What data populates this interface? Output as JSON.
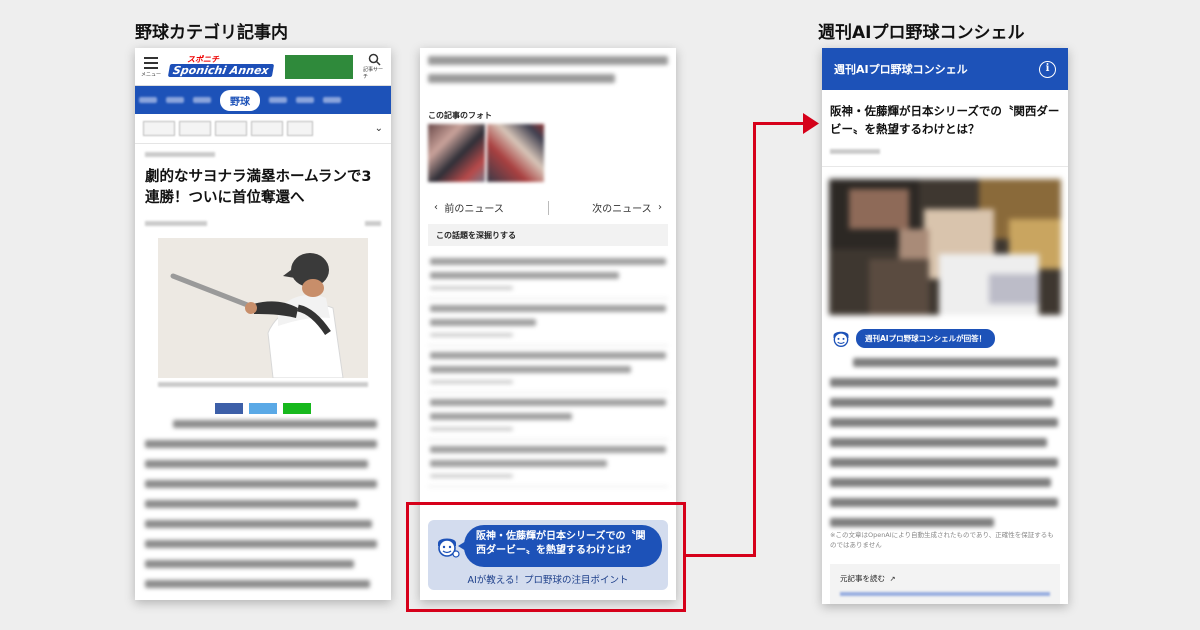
{
  "sections": {
    "left_title": "野球カテゴリ記事内",
    "right_title": "週刊AIプロ野球コンシェル"
  },
  "phone1": {
    "menu_label": "メニュー",
    "logo_top": "スポニチ",
    "logo_main": "Sponichi Annex",
    "search_label": "記事サーチ",
    "active_nav": "野球",
    "headline": "劇的なサヨナラ満塁ホームランで3連勝！ついに首位奪還へ"
  },
  "phone2": {
    "photos_label": "この記事のフォト",
    "prev_news": "前のニュース",
    "next_news": "次のニュース",
    "deep_dive_label": "この話題を深掘りする",
    "ai_question": "阪神・佐藤輝が日本シリーズでの〝関西ダービー〟を熱望するわけとは？",
    "ai_link": "AIが教える！プロ野球の注目ポイント"
  },
  "phone3": {
    "header_title": "週刊AIプロ野球コンシェル",
    "info_symbol": "i",
    "article_title": "阪神・佐藤輝が日本シリーズでの〝関西ダービー〟を熱望するわけとは？",
    "answer_badge": "週刊AIプロ野球コンシェルが回答！",
    "note": "※この文章はOpenAIにより自動生成されたものであり、正確性を保証するものではありません",
    "source_link": "元記事を読む"
  },
  "colors": {
    "brand_blue": "#1d52b8",
    "highlight_red": "#d6001a",
    "ai_card_bg": "#d3dcee"
  }
}
